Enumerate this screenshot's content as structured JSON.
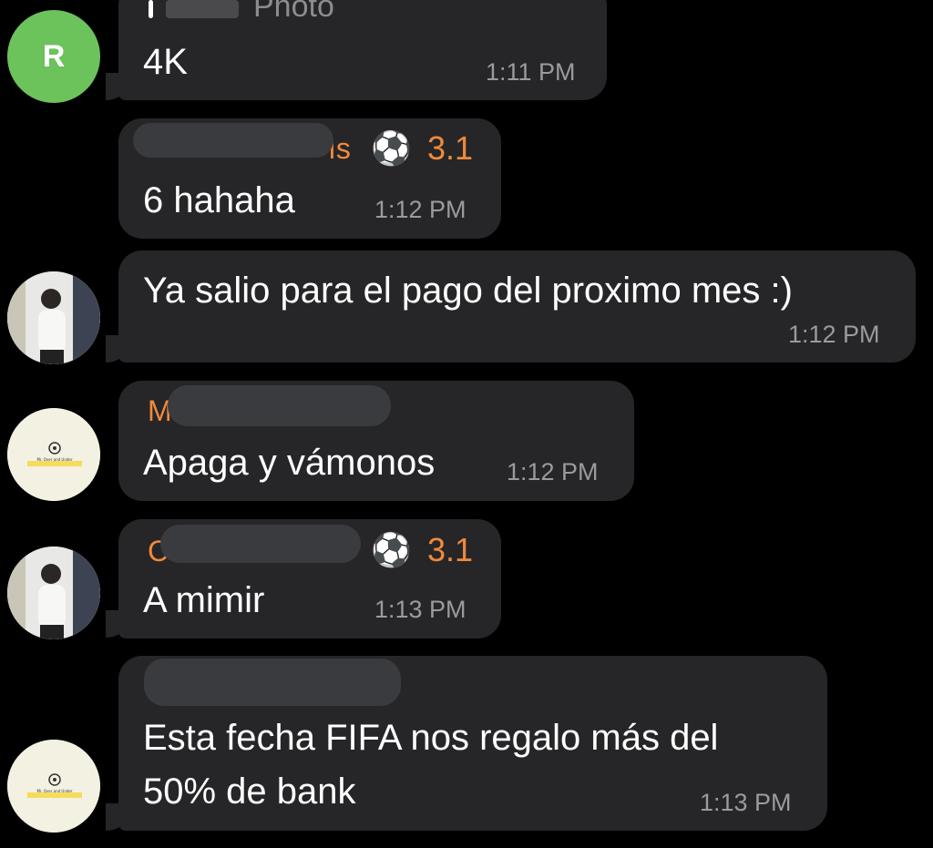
{
  "messages": [
    {
      "avatar_letter": "R",
      "reply_label": "Photo",
      "text": "4K",
      "time": "1:11 PM"
    },
    {
      "sender_visible": "ıs",
      "rank_emoji": "⚽",
      "rank": "3.1",
      "text": "6 hahaha",
      "time": "1:12 PM"
    },
    {
      "text": "Ya salio para el pago del proximo mes :)",
      "time": "1:12 PM"
    },
    {
      "sender_visible": "M",
      "text": "Apaga y vámonos",
      "time": "1:12 PM"
    },
    {
      "sender_visible": "C",
      "rank_emoji": "⚽",
      "rank": "3.1",
      "text": "A mimir",
      "time": "1:13 PM"
    },
    {
      "text_line1": "Esta fecha FIFA nos regalo más del",
      "text_line2": "50% de bank",
      "time": "1:13 PM"
    }
  ],
  "logo_text": "Mr. Over and Under",
  "colors": {
    "background": "#000000",
    "bubble": "#262628",
    "sender": "#f08a3c",
    "time": "#9a9aa0",
    "avatar_r": "#6cc25b"
  }
}
